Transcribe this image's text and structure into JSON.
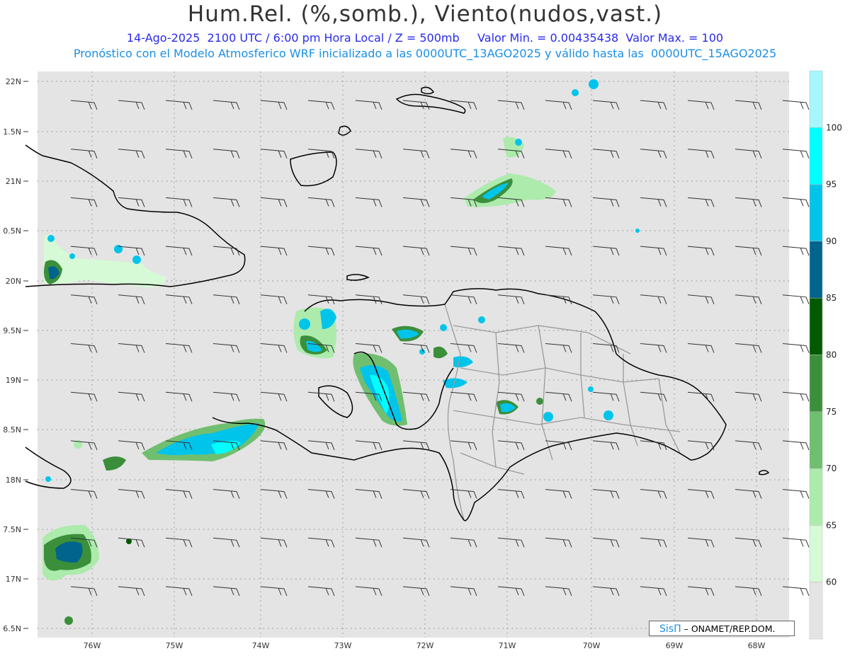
{
  "header": {
    "title": "Hum.Rel. (%,somb.), Viento(nudos,vast.)",
    "line1": "14-Ago-2025  2100 UTC / 6:00 pm Hora Local / Z = 500mb     Valor Min. = 0.00435438  Valor Max. = 100",
    "line2": "Pronóstico con el Modelo Atmosferico WRF inicializado a las 0000UTC_13AGO2025 y válido hasta las  0000UTC_15AGO2025"
  },
  "axes": {
    "lat_labels": [
      "22N",
      "1.5N",
      "21N",
      "0.5N",
      "20N",
      "9.5N",
      "19N",
      "8.5N",
      "18N",
      "7.5N",
      "17N",
      "6.5N"
    ],
    "lon_labels": [
      "76W",
      "75W",
      "74W",
      "73W",
      "72W",
      "71W",
      "70W",
      "69W",
      "68W"
    ]
  },
  "legend": {
    "levels": [
      "100",
      "95",
      "90",
      "85",
      "80",
      "75",
      "70",
      "65",
      "60"
    ],
    "colors": [
      "#a6f7fb",
      "#00ffff",
      "#00c4ea",
      "#00648c",
      "#005a00",
      "#3b8f3b",
      "#70bf70",
      "#acebac",
      "#d6fad6",
      "#e4e4e4"
    ]
  },
  "credit": {
    "brand": "SisΠ",
    "text": "– ONAMET/REP.DOM."
  },
  "colors": {
    "background": "#e4e4e4",
    "coast": "#000000",
    "borders": "#9a9a9a",
    "grid": "#9a9a9a"
  }
}
